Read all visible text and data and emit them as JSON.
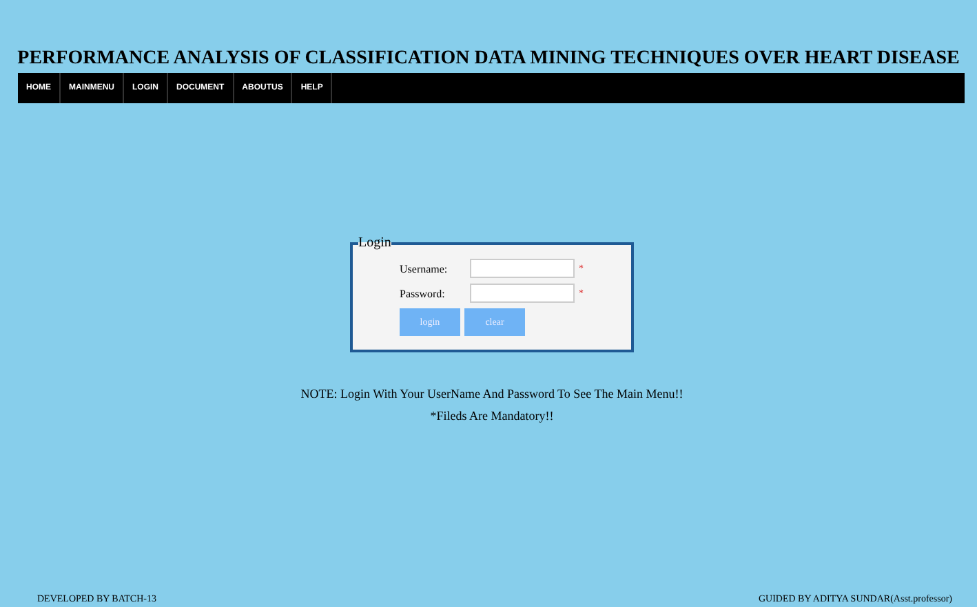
{
  "title": "PERFORMANCE ANALYSIS OF CLASSIFICATION DATA MINING TECHNIQUES OVER HEART DISEASE",
  "nav": [
    {
      "label": "HOME"
    },
    {
      "label": "MAINMENU"
    },
    {
      "label": "LOGIN"
    },
    {
      "label": "DOCUMENT"
    },
    {
      "label": "ABOUTUS"
    },
    {
      "label": "HELP"
    }
  ],
  "login": {
    "legend": "Login",
    "fields": [
      {
        "label": "Username:",
        "required_mark": "*"
      },
      {
        "label": "Password:",
        "required_mark": "*"
      }
    ],
    "buttons": [
      "login",
      "clear"
    ]
  },
  "notes": [
    "NOTE: Login With Your UserName And Password To See The Main Menu!!",
    "*Fileds Are Mandatory!!"
  ],
  "footer": {
    "left": "DEVELOPED BY BATCH-13",
    "right": "GUIDED BY ADITYA SUNDAR(Asst.professor)"
  }
}
